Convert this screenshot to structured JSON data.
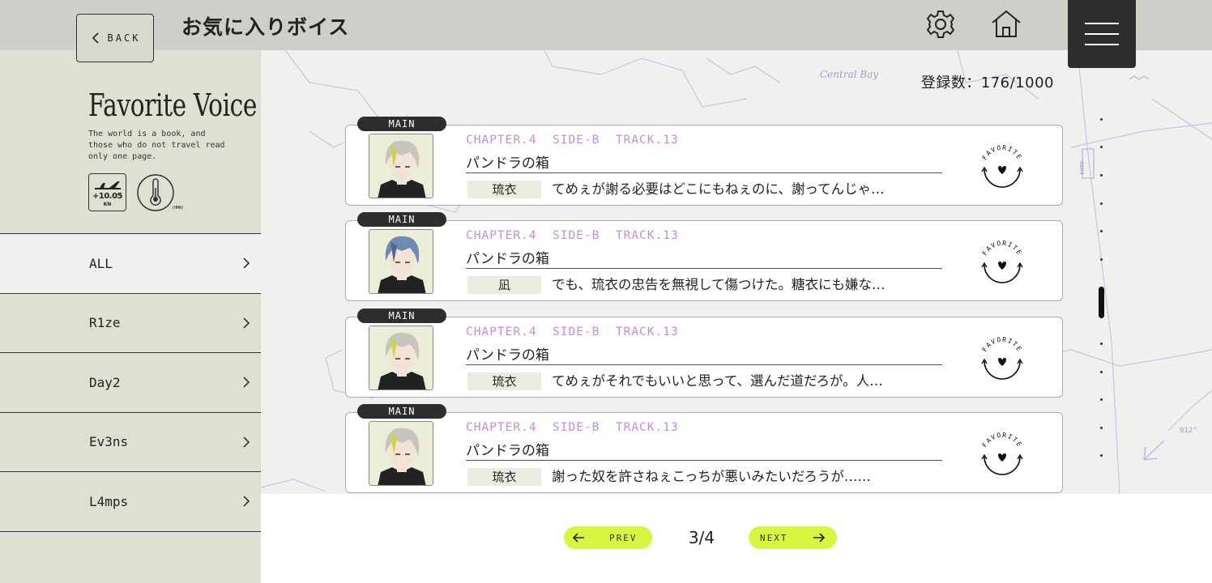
{
  "header": {
    "back_label": "BACK",
    "title": "お気に入りボイス",
    "settings_icon": "gear-icon",
    "home_icon": "home-icon",
    "menu_icon": "hamburger-icon"
  },
  "sidebar": {
    "heading": "Favorite Voice",
    "quote": "The world is a book, and those who do not travel read only one page.",
    "badge_speed": {
      "value": "+10.05",
      "unit": "KN"
    },
    "badge_temp": {
      "unit": "(HMN)"
    },
    "categories": [
      {
        "label": "ALL",
        "active": true
      },
      {
        "label": "R1ze",
        "active": false
      },
      {
        "label": "Day2",
        "active": false
      },
      {
        "label": "Ev3ns",
        "active": false
      },
      {
        "label": "L4mps",
        "active": false
      }
    ]
  },
  "main": {
    "count": "登録数：176/1000",
    "map_label": "Central Bay",
    "voices": [
      {
        "tag": "MAIN",
        "chapter": "CHAPTER.4  SIDE-B  TRACK.13",
        "song": "パンドラの箱",
        "speaker": "琉衣",
        "line": "てめぇが謝る必要はどこにもねぇのに、謝ってんじゃ…",
        "fav_label": "FAVORITE",
        "hair": "#c8c6bc",
        "streak": "#c9d64a"
      },
      {
        "tag": "MAIN",
        "chapter": "CHAPTER.4  SIDE-B  TRACK.13",
        "song": "パンドラの箱",
        "speaker": "凪",
        "line": "でも、琉衣の忠告を無視して傷つけた。糖衣にも嫌な…",
        "fav_label": "FAVORITE",
        "hair": "#6d8bb0",
        "streak": "#52688a"
      },
      {
        "tag": "MAIN",
        "chapter": "CHAPTER.4  SIDE-B  TRACK.13",
        "song": "パンドラの箱",
        "speaker": "琉衣",
        "line": "てめぇがそれでもいいと思って、選んだ道だろが。人…",
        "fav_label": "FAVORITE",
        "hair": "#c8c6bc",
        "streak": "#c9d64a"
      },
      {
        "tag": "MAIN",
        "chapter": "CHAPTER.4  SIDE-B  TRACK.13",
        "song": "パンドラの箱",
        "speaker": "琉衣",
        "line": "謝った奴を許さねぇこっちが悪いみたいだろうが……",
        "fav_label": "FAVORITE",
        "hair": "#c8c6bc",
        "streak": "#c9d64a"
      }
    ]
  },
  "pager": {
    "prev_label": "PREV",
    "next_label": "NEXT",
    "page": "3/4"
  },
  "colors": {
    "accent_lime": "#d8f542",
    "chapter_purple": "#c78bdb",
    "dark": "#2e2e2e"
  }
}
